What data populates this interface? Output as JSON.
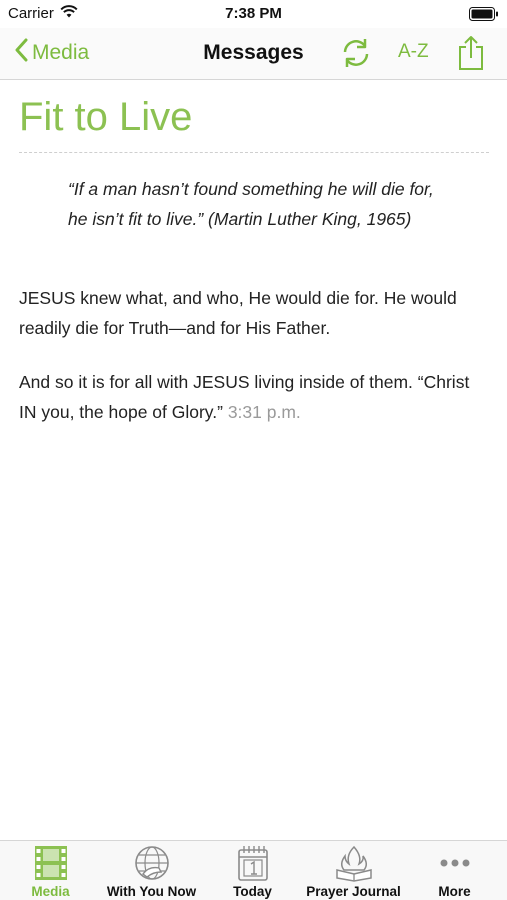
{
  "status_bar": {
    "carrier": "Carrier",
    "time": "7:38 PM"
  },
  "nav": {
    "back_label": "Media",
    "title": "Messages",
    "sort_label": "A-Z"
  },
  "message": {
    "title": "Fit to Live",
    "quote": "“If a man hasn’t found something he will die for, he isn’t fit to live.” (Martin Luther King, 1965)",
    "paragraph1": "JESUS knew what, and who, He would die for. He would readily die for Truth—and for His Father.",
    "paragraph2": "And so it is for all with JESUS living inside of them. “Christ IN you, the hope of Glory.”",
    "timestamp": "3:31 p.m."
  },
  "tabs": [
    {
      "label": "Media",
      "icon": "film-icon",
      "active": true
    },
    {
      "label": "With You Now",
      "icon": "globe-hand-icon",
      "active": false
    },
    {
      "label": "Today",
      "icon": "calendar-icon",
      "active": false
    },
    {
      "label": "Prayer Journal",
      "icon": "flame-book-icon",
      "active": false
    },
    {
      "label": "More",
      "icon": "more-dots-icon",
      "active": false
    }
  ],
  "colors": {
    "accent": "#7dbb3f",
    "title_green": "#8cc152",
    "timestamp_gray": "#9a9a9a"
  }
}
